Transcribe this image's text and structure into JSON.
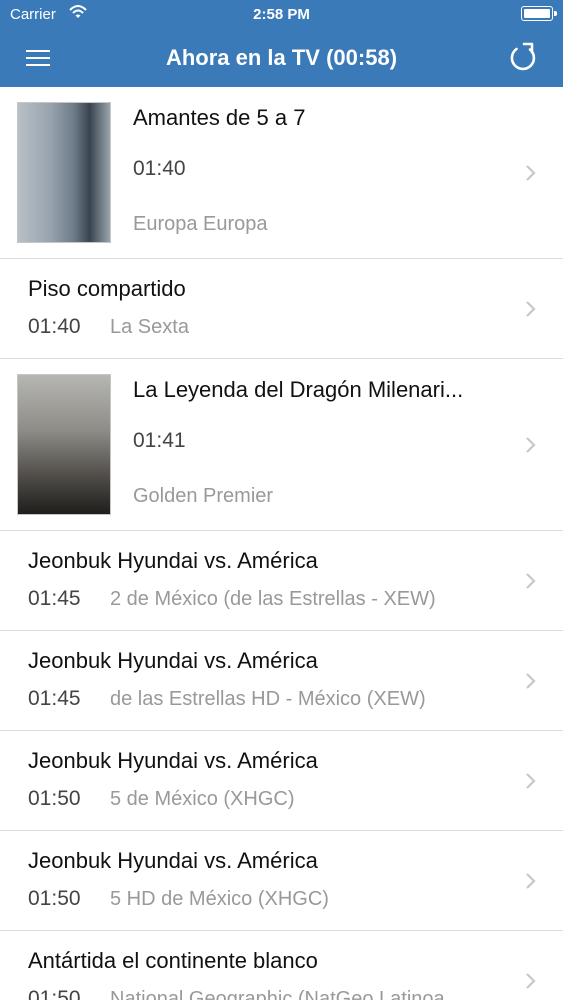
{
  "status_bar": {
    "carrier": "Carrier",
    "time": "2:58 PM"
  },
  "nav": {
    "title": "Ahora en la TV (00:58)",
    "menu_icon": "hamburger-menu-icon",
    "refresh_icon": "refresh-icon"
  },
  "colors": {
    "nav_background": "#3b7ab8",
    "text_primary": "#111111",
    "text_secondary": "#999999"
  },
  "programs": [
    {
      "title": "Amantes de 5 a 7",
      "time": "01:40",
      "channel": "Europa Europa",
      "has_thumbnail": true
    },
    {
      "title": "Piso compartido",
      "time": "01:40",
      "channel": "La Sexta",
      "has_thumbnail": false
    },
    {
      "title": "La Leyenda del Dragón Milenari...",
      "time": "01:41",
      "channel": "Golden Premier",
      "has_thumbnail": true
    },
    {
      "title": "Jeonbuk Hyundai vs. América",
      "time": "01:45",
      "channel": "2 de México (de las Estrellas - XEW)",
      "has_thumbnail": false
    },
    {
      "title": "Jeonbuk Hyundai vs. América",
      "time": "01:45",
      "channel": "de las Estrellas HD - México (XEW)",
      "has_thumbnail": false
    },
    {
      "title": "Jeonbuk Hyundai vs. América",
      "time": "01:50",
      "channel": "5 de México (XHGC)",
      "has_thumbnail": false
    },
    {
      "title": "Jeonbuk Hyundai vs. América",
      "time": "01:50",
      "channel": "5 HD de México (XHGC)",
      "has_thumbnail": false
    },
    {
      "title": "Antártida el continente blanco",
      "time": "01:50",
      "channel": "National Geographic (NatGeo Latinoa",
      "has_thumbnail": false
    }
  ]
}
